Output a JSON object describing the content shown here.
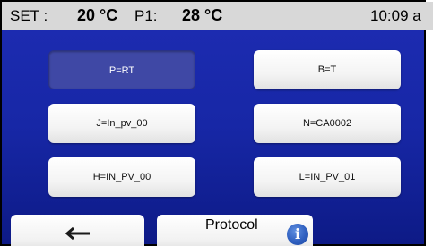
{
  "status": {
    "set_label": "SET :",
    "set_value": "20 °C",
    "p1_label": "P1:",
    "p1_value": "28 °C",
    "time": "10:09 a"
  },
  "keys": [
    {
      "label": "P=RT",
      "selected": true
    },
    {
      "label": "B=T",
      "selected": false
    },
    {
      "label": "J=In_pv_00",
      "selected": false
    },
    {
      "label": "N=CA0002",
      "selected": false
    },
    {
      "label": "H=IN_PV_00",
      "selected": false
    },
    {
      "label": "L=IN_PV_01",
      "selected": false
    }
  ],
  "bottom": {
    "back_icon": "arrow-left-icon",
    "protocol_label": "Protocol",
    "info_icon": "info-icon",
    "info_glyph": "i"
  },
  "colors": {
    "panel_blue": "#1c2bb0",
    "status_bar": "#d8d8d8",
    "selected_key": "#3f48a5",
    "info_blue": "#2f5fbf"
  }
}
